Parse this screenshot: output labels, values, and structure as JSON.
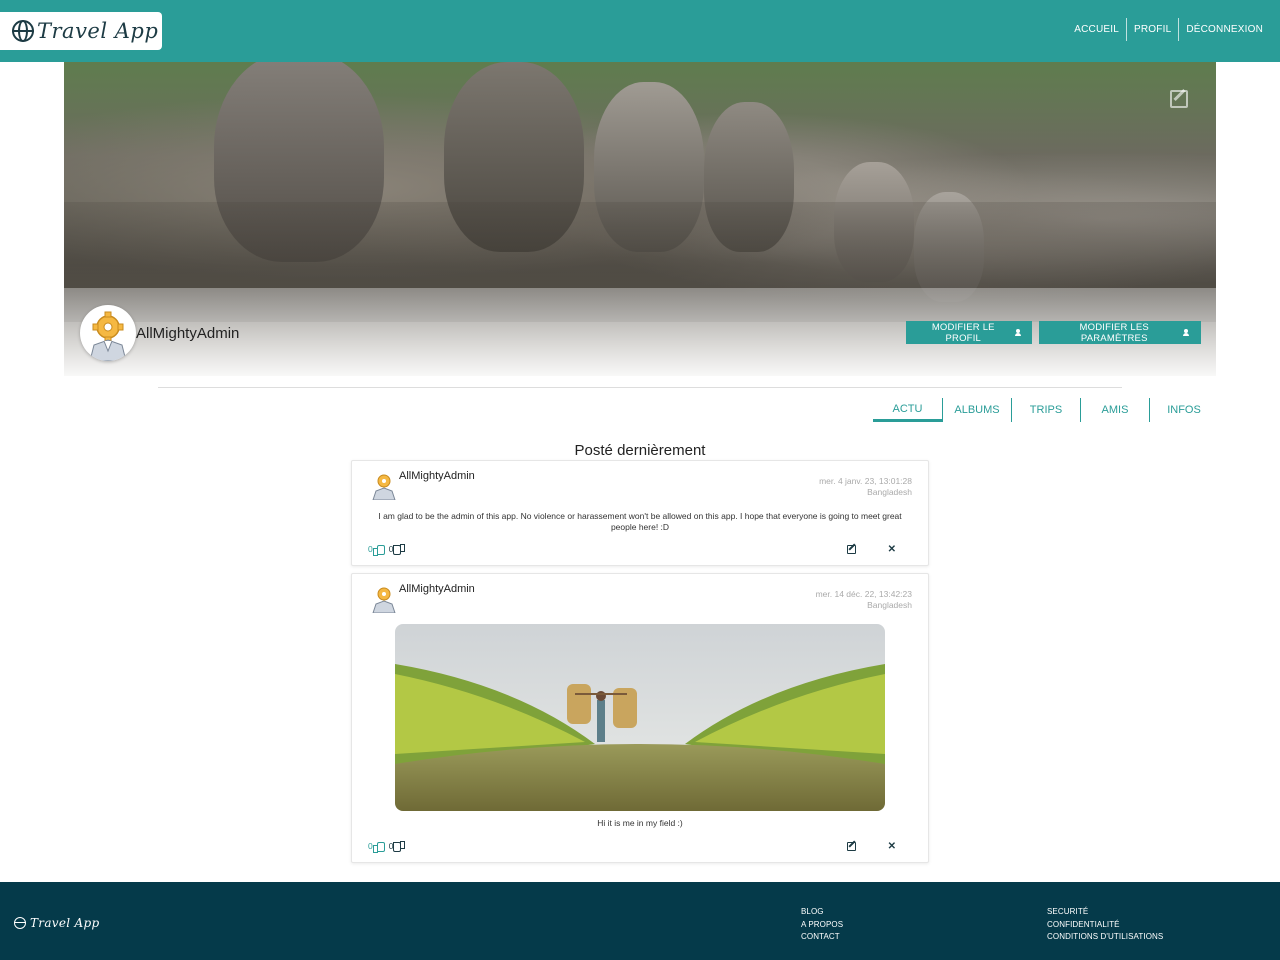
{
  "header": {
    "logo_text": "Travel App",
    "nav": [
      "ACCUEIL",
      "PROFIL",
      "DÉCONNEXION"
    ]
  },
  "profile": {
    "username": "AllMightyAdmin",
    "edit_profile_label": "MODIFIER LE PROFIL",
    "edit_settings_label": "MODIFIER LES PARAMÈTRES"
  },
  "tabs": [
    "ACTU",
    "ALBUMS",
    "TRIPS",
    "AMIS",
    "INFOS"
  ],
  "active_tab": "ACTU",
  "section_title": "Posté dernièrement",
  "posts": [
    {
      "author": "AllMightyAdmin",
      "date": "mer. 4 janv. 23, 13:01:28",
      "location": "Bangladesh",
      "text": "I am glad to be the admin of this app. No violence or harassement won't be allowed on this app. I hope that everyone is going to meet great people here! :D",
      "likes": "0",
      "dislikes": "0"
    },
    {
      "author": "AllMightyAdmin",
      "date": "mer. 14 déc. 22, 13:42:23",
      "location": "Bangladesh",
      "caption": "Hi it is me in my field :)",
      "likes": "0",
      "dislikes": "0"
    }
  ],
  "footer": {
    "logo_text": "Travel App",
    "col1": [
      "BLOG",
      "A PROPOS",
      "CONTACT"
    ],
    "col2": [
      "SECURITÉ",
      "CONFIDENTIALITÉ",
      "CONDITIONS D'UTILISATIONS"
    ]
  },
  "colors": {
    "primary": "#2a9d98",
    "footer": "#053a4a",
    "logo": "#1d3b44"
  }
}
